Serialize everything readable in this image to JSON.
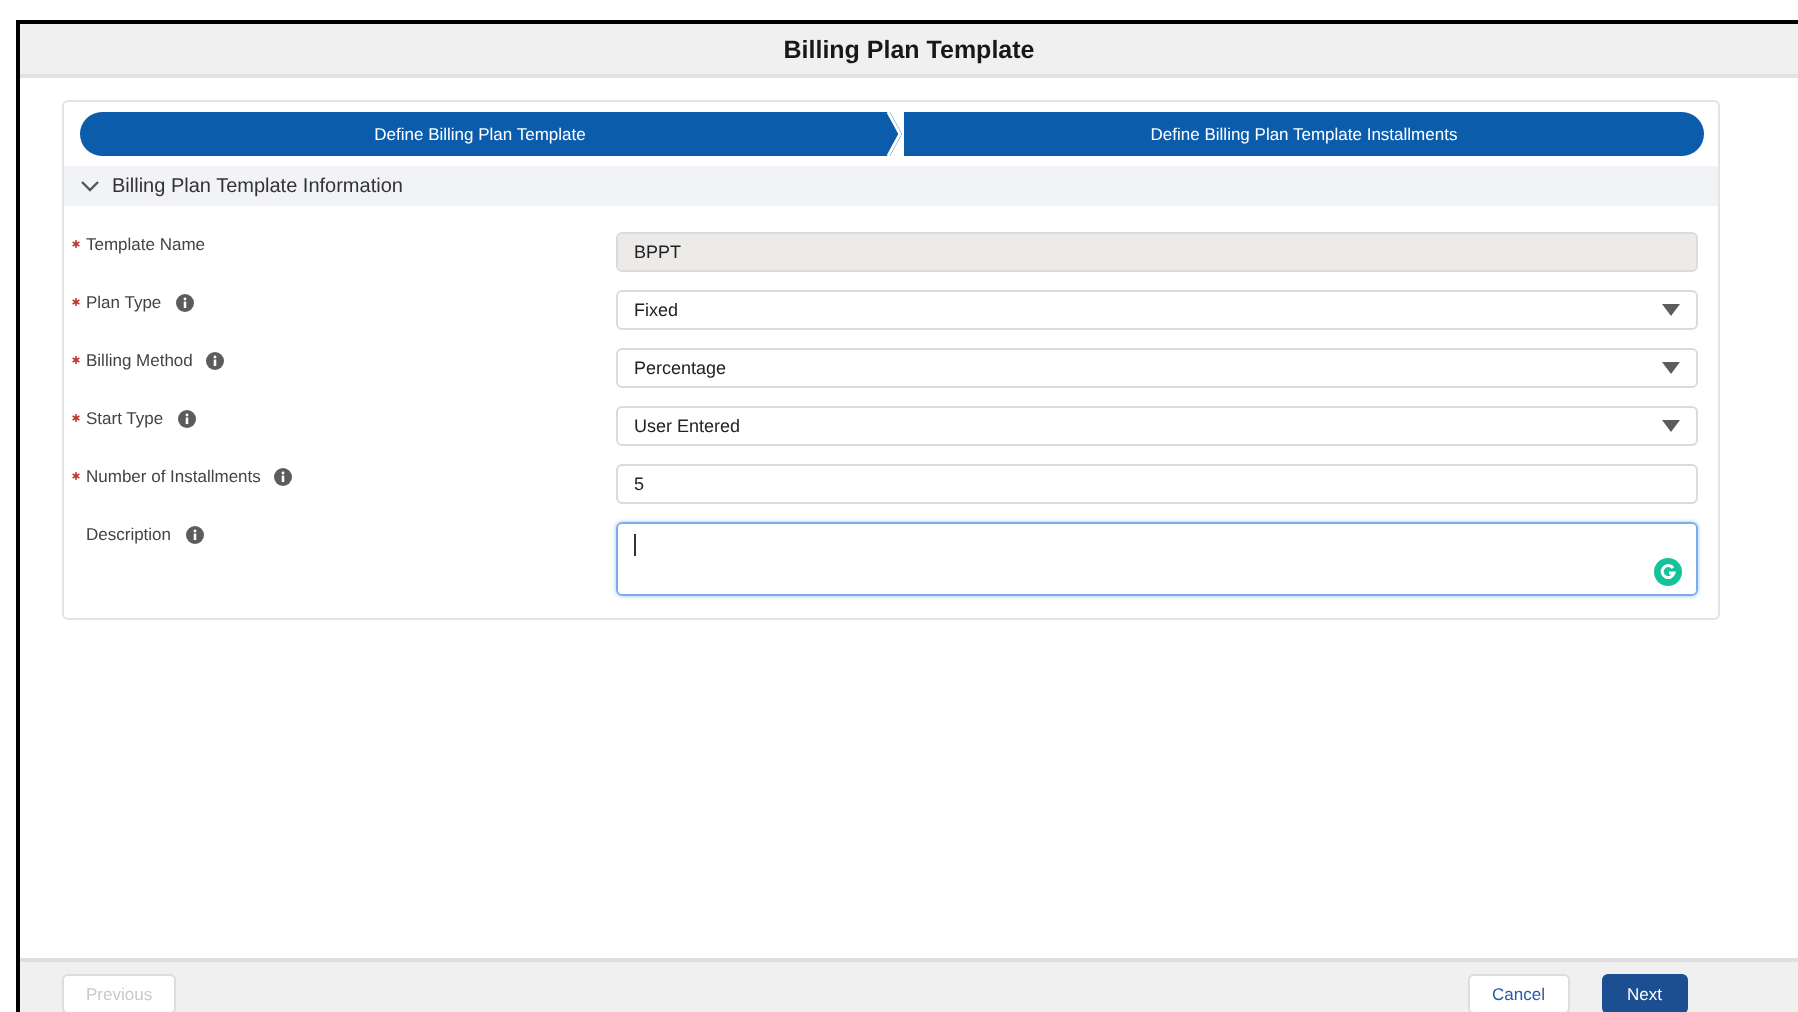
{
  "window": {
    "title": "Billing Plan Template"
  },
  "path": [
    {
      "label": "Define Billing Plan Template"
    },
    {
      "label": "Define Billing Plan Template Installments"
    }
  ],
  "section": {
    "title": "Billing Plan Template Information",
    "expanded": true
  },
  "fields": [
    {
      "label": "Template Name",
      "required": true,
      "info": false,
      "kind": "readonly",
      "value": "BPPT"
    },
    {
      "label": "Plan Type",
      "required": true,
      "info": true,
      "kind": "select",
      "value": "Fixed"
    },
    {
      "label": "Billing Method",
      "required": true,
      "info": true,
      "kind": "select",
      "value": "Percentage"
    },
    {
      "label": "Start Type",
      "required": true,
      "info": true,
      "kind": "select",
      "value": "User Entered"
    },
    {
      "label": "Number of Installments",
      "required": true,
      "info": true,
      "kind": "text",
      "value": "5"
    },
    {
      "label": "Description",
      "required": false,
      "info": true,
      "kind": "textarea"
    }
  ],
  "footer": [
    {
      "label": "Previous",
      "disabled": true,
      "kind": "neutral"
    },
    {
      "label": "Cancel",
      "disabled": false,
      "kind": "neutral"
    },
    {
      "label": "Next",
      "disabled": false,
      "kind": "brand"
    }
  ]
}
